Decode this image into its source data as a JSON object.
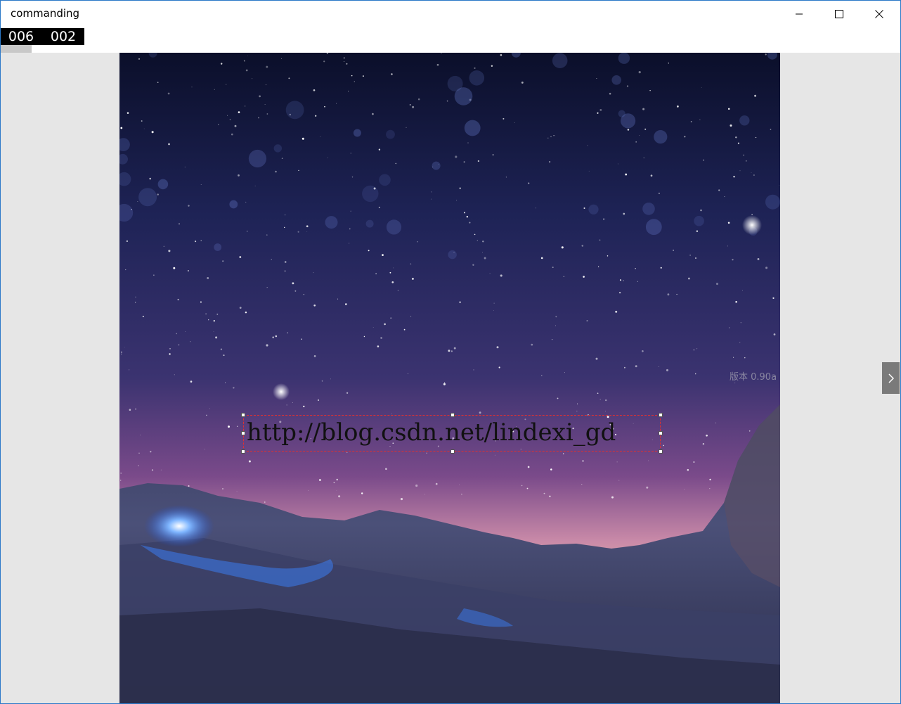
{
  "window": {
    "title": "commanding"
  },
  "counter": {
    "left": "006",
    "right": "002"
  },
  "progress": {
    "fraction": 0.035
  },
  "slide": {
    "url_text": "http://blog.csdn.net/lindexi_gd",
    "watermark": "版本 0.90a"
  },
  "icons": {
    "minimize": "minimize-icon",
    "maximize": "maximize-icon",
    "close": "close-icon",
    "next": "chevron-right-icon"
  },
  "colors": {
    "selection_border": "#e03030",
    "window_border": "#2b78c8"
  }
}
